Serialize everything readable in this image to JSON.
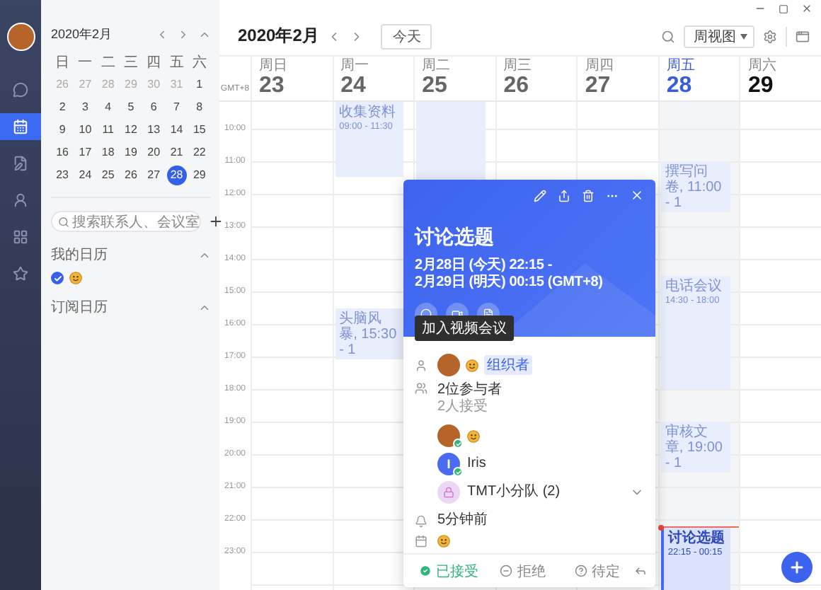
{
  "rail": {
    "items": [
      {
        "kind": "chat",
        "selected": false
      },
      {
        "kind": "calendar",
        "selected": true
      },
      {
        "kind": "docs",
        "selected": false
      },
      {
        "kind": "contacts",
        "selected": false
      },
      {
        "kind": "apps",
        "selected": false
      },
      {
        "kind": "favorites",
        "selected": false
      }
    ]
  },
  "mini_calendar": {
    "title": "2020年2月",
    "weekdays": [
      "日",
      "一",
      "二",
      "三",
      "四",
      "五",
      "六"
    ],
    "weeks": [
      [
        {
          "day": "26",
          "muted": true,
          "selected": false
        },
        {
          "day": "27",
          "muted": true,
          "selected": false
        },
        {
          "day": "28",
          "muted": true,
          "selected": false
        },
        {
          "day": "29",
          "muted": true,
          "selected": false
        },
        {
          "day": "30",
          "muted": true,
          "selected": false
        },
        {
          "day": "31",
          "muted": true,
          "selected": false
        },
        {
          "day": "1",
          "muted": false,
          "selected": false
        }
      ],
      [
        {
          "day": "2",
          "muted": false,
          "selected": false
        },
        {
          "day": "3",
          "muted": false,
          "selected": false
        },
        {
          "day": "4",
          "muted": false,
          "selected": false
        },
        {
          "day": "5",
          "muted": false,
          "selected": false
        },
        {
          "day": "6",
          "muted": false,
          "selected": false
        },
        {
          "day": "7",
          "muted": false,
          "selected": false
        },
        {
          "day": "8",
          "muted": false,
          "selected": false
        }
      ],
      [
        {
          "day": "9",
          "muted": false,
          "selected": false
        },
        {
          "day": "10",
          "muted": false,
          "selected": false
        },
        {
          "day": "11",
          "muted": false,
          "selected": false
        },
        {
          "day": "12",
          "muted": false,
          "selected": false
        },
        {
          "day": "13",
          "muted": false,
          "selected": false
        },
        {
          "day": "14",
          "muted": false,
          "selected": false
        },
        {
          "day": "15",
          "muted": false,
          "selected": false
        }
      ],
      [
        {
          "day": "16",
          "muted": false,
          "selected": false
        },
        {
          "day": "17",
          "muted": false,
          "selected": false
        },
        {
          "day": "18",
          "muted": false,
          "selected": false
        },
        {
          "day": "19",
          "muted": false,
          "selected": false
        },
        {
          "day": "20",
          "muted": false,
          "selected": false
        },
        {
          "day": "21",
          "muted": false,
          "selected": false
        },
        {
          "day": "22",
          "muted": false,
          "selected": false
        }
      ],
      [
        {
          "day": "23",
          "muted": false,
          "selected": false
        },
        {
          "day": "24",
          "muted": false,
          "selected": false
        },
        {
          "day": "25",
          "muted": false,
          "selected": false
        },
        {
          "day": "26",
          "muted": false,
          "selected": false
        },
        {
          "day": "27",
          "muted": false,
          "selected": false
        },
        {
          "day": "28",
          "muted": false,
          "selected": true
        },
        {
          "day": "29",
          "muted": false,
          "selected": false
        }
      ]
    ]
  },
  "search": {
    "placeholder": "搜索联系人、会议室"
  },
  "calendar_sections": [
    {
      "title": "我的日历",
      "expanded": true,
      "calendars": [
        {
          "checked": true
        }
      ]
    },
    {
      "title": "订阅日历",
      "expanded": true
    }
  ],
  "toolbar": {
    "title": "2020年2月",
    "today_button": "今天",
    "view": "周视图"
  },
  "week": {
    "timezone": "GMT+8",
    "hours": [
      "10:00",
      "11:00",
      "12:00",
      "13:00",
      "14:00",
      "15:00",
      "16:00",
      "17:00",
      "18:00",
      "19:00",
      "20:00",
      "21:00",
      "22:00",
      "23:00"
    ],
    "days": [
      {
        "weekday": "周日",
        "date": "23",
        "past": true,
        "today": false
      },
      {
        "weekday": "周一",
        "date": "24",
        "past": true,
        "today": false,
        "events": [
          {
            "kind": "stacked",
            "title": "收集资料",
            "time": "09:00 - 11:30",
            "selected": false
          },
          {
            "kind": "inline",
            "text": "头脑风暴, 15:30 - 1",
            "selected": false
          }
        ]
      },
      {
        "weekday": "周二",
        "date": "25",
        "past": true,
        "today": false,
        "events": [
          {
            "kind": "blank",
            "selected": false
          }
        ]
      },
      {
        "weekday": "周三",
        "date": "26",
        "past": true,
        "today": false
      },
      {
        "weekday": "周四",
        "date": "27",
        "past": true,
        "today": false
      },
      {
        "weekday": "周五",
        "date": "28",
        "past": false,
        "today": true,
        "events": [
          {
            "kind": "inline",
            "text": "撰写问卷, 11:00 - 1",
            "selected": false
          },
          {
            "kind": "stacked",
            "title": "电话会议",
            "time": "14:30 - 18:00",
            "selected": false
          },
          {
            "kind": "inline",
            "text": "审核文章, 19:00 - 1",
            "selected": false
          },
          {
            "kind": "stacked",
            "title": "讨论选题",
            "time": "22:15 - 00:15",
            "selected": true
          }
        ]
      },
      {
        "weekday": "周六",
        "date": "29",
        "past": false,
        "today": false
      }
    ]
  },
  "event_popup": {
    "title": "讨论选题",
    "time_lines": [
      "2月28日 (今天) 22:15 -",
      "2月29日 (明天) 00:15 (GMT+8)"
    ],
    "tooltip": "加入视频会议",
    "organizer_tag": "组织者",
    "participants": {
      "title": "2位参与者",
      "subtitle": "2人接受"
    },
    "attendees": [
      {
        "kind": "person",
        "accepted": true
      },
      {
        "kind": "person",
        "initial": "I",
        "name": "Iris",
        "accepted": true
      },
      {
        "kind": "group",
        "name": "TMT小分队 (2)",
        "expanded": false
      }
    ],
    "reminder": "5分钟前",
    "responses": [
      {
        "label": "已接受",
        "selected": true
      },
      {
        "label": "拒绝",
        "selected": false
      },
      {
        "label": "待定",
        "selected": false
      }
    ]
  }
}
